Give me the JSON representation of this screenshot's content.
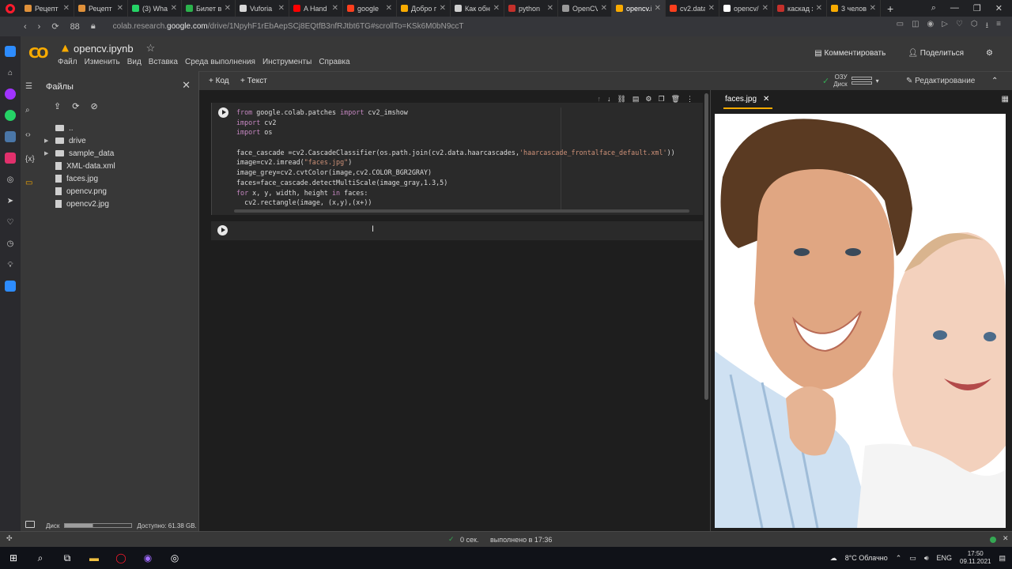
{
  "browser": {
    "tabs": [
      {
        "title": "Рецепт",
        "color": "#e0913a"
      },
      {
        "title": "Рецепт",
        "color": "#e0913a"
      },
      {
        "title": "(3) What",
        "color": "#25d366"
      },
      {
        "title": "Билет в",
        "color": "#2bb24c"
      },
      {
        "title": "Vuforia",
        "color": "#d8d8d8"
      },
      {
        "title": "A Hand",
        "color": "#ff0000"
      },
      {
        "title": "google",
        "color": "#fc3f1d"
      },
      {
        "title": "Добро п",
        "color": "#f9ab00"
      },
      {
        "title": "Как обн",
        "color": "#cfcfcf"
      },
      {
        "title": "python",
        "color": "#c4302b"
      },
      {
        "title": "OpenCV",
        "color": "#9a9a9a"
      },
      {
        "title": "opencv.ip",
        "color": "#f9ab00",
        "active": true
      },
      {
        "title": "cv2.data",
        "color": "#fc3f1d"
      },
      {
        "title": "opencv/",
        "color": "#ffffff"
      },
      {
        "title": "каскад х",
        "color": "#c4302b"
      },
      {
        "title": "3 челове",
        "color": "#f9ab00"
      }
    ],
    "new_tab": "+",
    "url_prefix": "colab.research.",
    "url_domain": "google.com",
    "url_path": "/drive/1NpyhF1rEbAepSCj8EQtfB3nfRJtbt6TG#scrollTo=KSk6M0bN9ccT",
    "nav_back": "‹",
    "nav_forward": "›",
    "reload": "⟳",
    "speed_dial": "88"
  },
  "colab": {
    "notebook_title": "opencv.ipynb",
    "star": "☆",
    "menu": [
      "Файл",
      "Изменить",
      "Вид",
      "Вставка",
      "Среда выполнения",
      "Инструменты",
      "Справка"
    ],
    "comment_label": "Комментировать",
    "share_label": "Поделиться",
    "add_code": "+ Код",
    "add_text": "+ Текст",
    "ram_label": "ОЗУ",
    "disk_label": "Диск",
    "edit_mode": "Редактирование"
  },
  "files": {
    "title": "Файлы",
    "items": [
      {
        "name": "..",
        "type": "folder",
        "expandable": false
      },
      {
        "name": "drive",
        "type": "folder",
        "expandable": true
      },
      {
        "name": "sample_data",
        "type": "folder",
        "expandable": true
      },
      {
        "name": "XML-data.xml",
        "type": "file"
      },
      {
        "name": "faces.jpg",
        "type": "file"
      },
      {
        "name": "opencv.png",
        "type": "file"
      },
      {
        "name": "opencv2.jpg",
        "type": "file"
      }
    ],
    "disk_label": "Диск",
    "disk_available": "Доступно: 61.38 GB.",
    "disk_used_fraction": 0.42
  },
  "cell": {
    "lines": [
      [
        {
          "t": "from ",
          "c": "kw"
        },
        {
          "t": "google.colab.patches ",
          "c": ""
        },
        {
          "t": "import ",
          "c": "kw"
        },
        {
          "t": "cv2_imshow",
          "c": ""
        }
      ],
      [
        {
          "t": "import ",
          "c": "kw"
        },
        {
          "t": "cv2",
          "c": ""
        }
      ],
      [
        {
          "t": "import ",
          "c": "kw"
        },
        {
          "t": "os",
          "c": ""
        }
      ],
      [],
      [
        {
          "t": "face_cascade =cv2.CascadeClassifier(os.path.join(cv2.data.haarcascades,",
          "c": ""
        },
        {
          "t": "'haarcascade_frontalface_default.xml'",
          "c": "str"
        },
        {
          "t": "))",
          "c": ""
        }
      ],
      [
        {
          "t": "image=cv2.imread(",
          "c": ""
        },
        {
          "t": "\"faces.jpg\"",
          "c": "str"
        },
        {
          "t": ")",
          "c": ""
        }
      ],
      [
        {
          "t": "image_grey=cv2.cvtColor(image,cv2.COLOR_BGR2GRAY)",
          "c": ""
        }
      ],
      [
        {
          "t": "faces=face_cascade.detectMultiScale(image_gray,1.3,5)",
          "c": ""
        }
      ],
      [
        {
          "t": "for ",
          "c": "kw"
        },
        {
          "t": "x, y, width, height ",
          "c": ""
        },
        {
          "t": "in ",
          "c": "kw"
        },
        {
          "t": "faces:",
          "c": ""
        }
      ],
      [
        {
          "t": "  cv2.rectangle(image, (x,y),(x+))",
          "c": ""
        }
      ]
    ]
  },
  "preview": {
    "filename": "faces.jpg"
  },
  "status": {
    "check": "✓",
    "elapsed": "0 сек.",
    "done": "выполнено в 17:36"
  },
  "taskbar": {
    "weather": "8°C  Облачно",
    "lang": "ENG",
    "time": "17:50",
    "date": "09.11.2021"
  }
}
